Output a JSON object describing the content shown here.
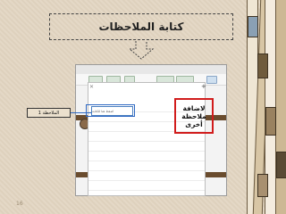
{
  "title": "كتابة الملاحظات",
  "add_note_label": "لاضافة\nملاحظة\nأخرى",
  "note_label": "الملاحظة 1",
  "note_input_placeholder": "اضغط هنا للكتابة",
  "page_number": "16",
  "colors": {
    "background": "#e2d5c1",
    "highlight_red": "#d11c1c",
    "highlight_blue": "#2f68c2"
  },
  "icons": {
    "down_arrow": "dashed-down-arrow-icon",
    "close": "close-icon",
    "add": "plus-icon"
  }
}
